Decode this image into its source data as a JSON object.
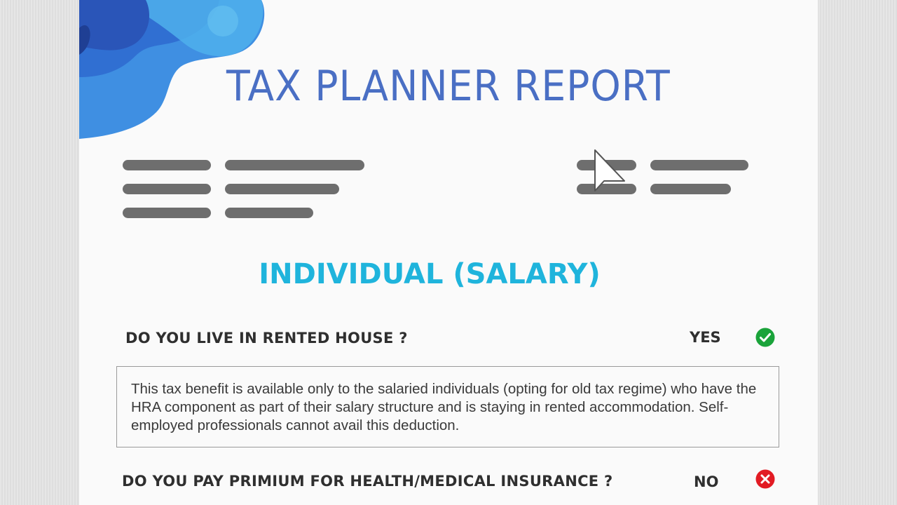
{
  "report": {
    "title": "TAX PLANNER REPORT",
    "section_title": "INDIVIDUAL (SALARY)"
  },
  "questions": [
    {
      "text": "DO YOU LIVE IN RENTED HOUSE ?",
      "answer": "YES",
      "status_icon": "check-circle-icon",
      "status_color": "#1aa33a",
      "info": "This tax benefit is available only to the salaried individuals (opting for old tax regime) who have the HRA component as part of their salary structure and is staying in rented accommodation. Self-employed professionals cannot avail this deduction."
    },
    {
      "text": "DO YOU PAY PRIMIUM FOR HEALTH/MEDICAL INSURANCE ?",
      "answer": "NO",
      "status_icon": "x-circle-icon",
      "status_color": "#e21b23"
    }
  ],
  "colors": {
    "title": "#4a6fc4",
    "section_title": "#1fb4dc",
    "placeholder_bar": "#6e6e6e",
    "decor_primary": "#3d8fe0",
    "decor_dark": "#2a55b8"
  }
}
